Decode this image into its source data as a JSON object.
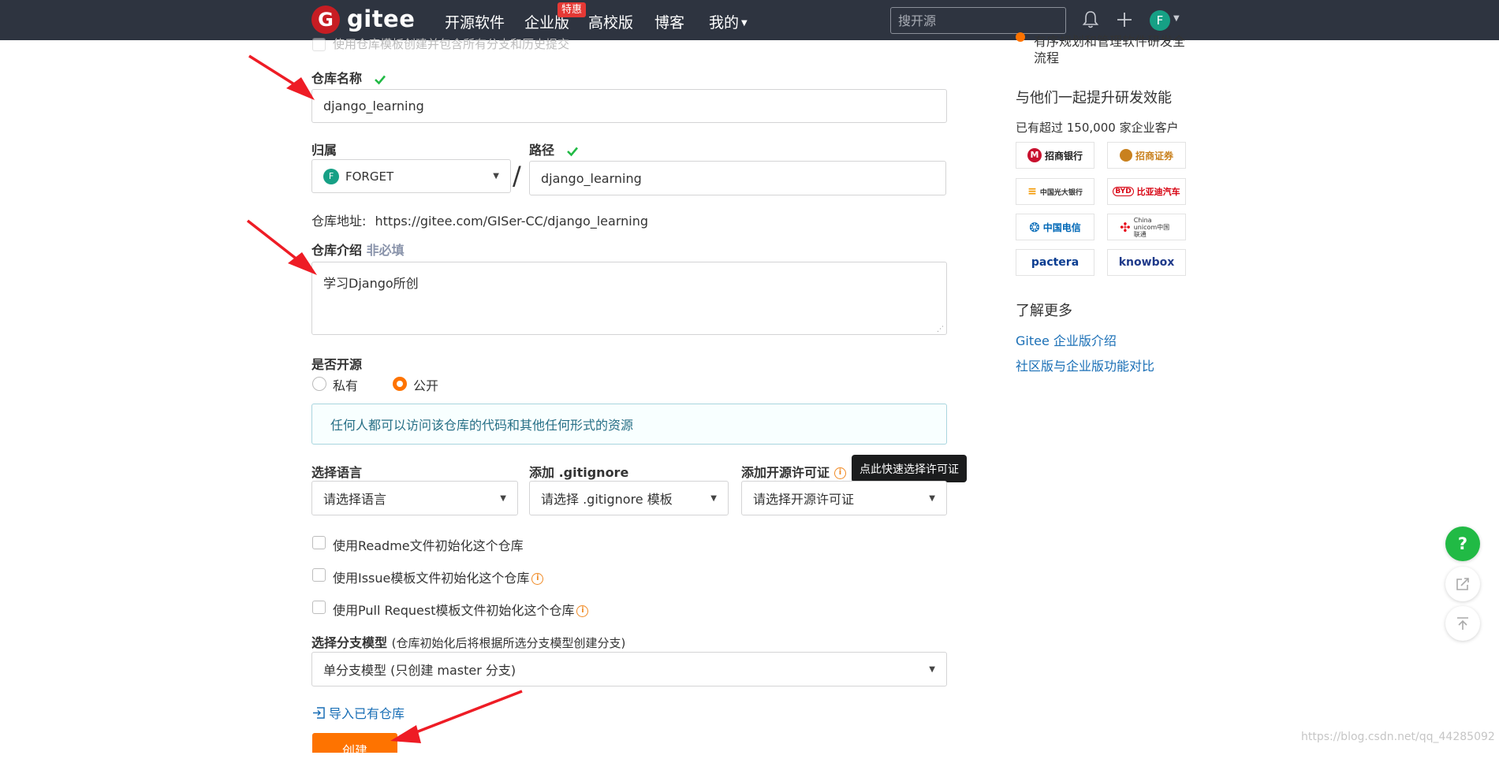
{
  "header": {
    "logo_letter": "G",
    "logo_text": "gitee",
    "nav": [
      "开源软件",
      "企业版",
      "高校版",
      "博客",
      "我的"
    ],
    "enterprise_badge": "特惠",
    "search_placeholder": "搜开源",
    "avatar_letter": "F",
    "brand_color": "#c71d23"
  },
  "form": {
    "template_checkbox_label": "使用仓库模板创建并包含所有分支和历史提交",
    "repo_name_label": "仓库名称",
    "repo_name_value": "django_learning",
    "owner_label": "归属",
    "owner_avatar": "F",
    "owner_value": "FORGET",
    "slash": "/",
    "path_label": "路径",
    "path_value": "django_learning",
    "address_label": "仓库地址:",
    "address_value": "https://gitee.com/GISer-CC/django_learning",
    "intro_label": "仓库介绍",
    "intro_optional": "非必填",
    "intro_value": "学习Django所创",
    "open_source_label": "是否开源",
    "private_label": "私有",
    "public_label": "公开",
    "selected_visibility": "public",
    "public_note": "任何人都可以访问该仓库的代码和其他任何形式的资源",
    "language_label": "选择语言",
    "language_value": "请选择语言",
    "gitignore_label": "添加 .gitignore",
    "gitignore_value": "请选择 .gitignore 模板",
    "license_label": "添加开源许可证",
    "license_value": "请选择开源许可证",
    "license_tooltip": "点此快速选择许可证",
    "readme_label": "使用Readme文件初始化这个仓库",
    "issue_label": "使用Issue模板文件初始化这个仓库",
    "pr_label": "使用Pull Request模板文件初始化这个仓库",
    "branch_label": "选择分支模型",
    "branch_note": "(仓库初始化后将根据所选分支模型创建分支)",
    "branch_value": "单分支模型 (只创建 master 分支)",
    "import_label": "导入已有仓库",
    "create_button": "创建",
    "create_color": "#fe7300"
  },
  "sidebar": {
    "top_text_1": "有序规划和管理软件研发全",
    "top_text_2": "流程",
    "boost_title": "与他们一起提升研发效能",
    "customers_text": "已有超过 150,000 家企业客户",
    "logos": [
      {
        "name": "招商银行",
        "color": "#c8102e"
      },
      {
        "name": "招商证券",
        "color": "#c9811e"
      },
      {
        "name": "中国光大银行",
        "color": "#f39800"
      },
      {
        "name": "比亚迪汽车",
        "color": "#d7000f"
      },
      {
        "name": "中国电信",
        "color": "#0068b7"
      },
      {
        "name": "China unicom中国联通",
        "color": "#e60012"
      },
      {
        "name": "pactera",
        "color": "#0a3d91"
      },
      {
        "name": "knowbox",
        "color": "#1f3a8a"
      }
    ],
    "learn_more_title": "了解更多",
    "links": [
      "Gitee 企业版介绍",
      "社区版与企业版功能对比"
    ]
  },
  "floating": {
    "help": "?"
  },
  "watermark": "https://blog.csdn.net/qq_44285092"
}
